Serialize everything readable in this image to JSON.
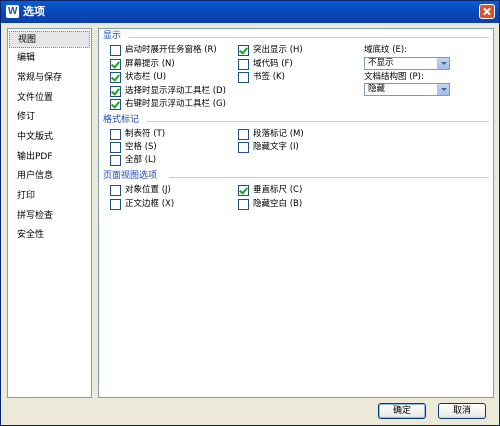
{
  "window": {
    "title": "选项",
    "close_icon": "close-icon"
  },
  "sidebar": {
    "items": [
      {
        "label": "视图",
        "selected": true
      },
      {
        "label": "编辑",
        "selected": false
      },
      {
        "label": "常规与保存",
        "selected": false
      },
      {
        "label": "文件位置",
        "selected": false
      },
      {
        "label": "修订",
        "selected": false
      },
      {
        "label": "中文版式",
        "selected": false
      },
      {
        "label": "输出PDF",
        "selected": false
      },
      {
        "label": "用户信息",
        "selected": false
      },
      {
        "label": "打印",
        "selected": false
      },
      {
        "label": "拼写检查",
        "selected": false
      },
      {
        "label": "安全性",
        "selected": false
      }
    ]
  },
  "display": {
    "title": "显示",
    "options": [
      {
        "label": "启动时展开任务窗格 (R)",
        "checked": false
      },
      {
        "label": "屏幕提示 (N)",
        "checked": true
      },
      {
        "label": "状态栏 (U)",
        "checked": true
      },
      {
        "label": "选择时显示浮动工具栏 (D)",
        "checked": true
      },
      {
        "label": "右键时显示浮动工具栏 (G)",
        "checked": true
      },
      {
        "label": "突出显示 (H)",
        "checked": true
      },
      {
        "label": "域代码 (F)",
        "checked": false
      },
      {
        "label": "书签 (K)",
        "checked": false
      }
    ],
    "field_shading_label": "域底纹 (E):",
    "field_shading_value": "不显示",
    "doc_map_label": "文档结构图 (P):",
    "doc_map_value": "隐藏"
  },
  "format_marks": {
    "title": "格式标记",
    "options": [
      {
        "label": "制表符 (T)",
        "checked": false
      },
      {
        "label": "空格 (S)",
        "checked": false
      },
      {
        "label": "全部 (L)",
        "checked": false
      },
      {
        "label": "段落标记 (M)",
        "checked": false
      },
      {
        "label": "隐藏文字 (I)",
        "checked": false
      }
    ]
  },
  "page_view": {
    "title": "页面视图选项",
    "options": [
      {
        "label": "对象位置 (J)",
        "checked": false
      },
      {
        "label": "正文边框 (X)",
        "checked": false
      },
      {
        "label": "垂直标尺 (C)",
        "checked": true
      },
      {
        "label": "隐藏空白 (B)",
        "checked": false
      }
    ]
  },
  "buttons": {
    "ok": "确定",
    "cancel": "取消"
  },
  "colors": {
    "accent": "#1a46b4",
    "title_bar": "#0a5ed8",
    "check": "#21a121"
  }
}
